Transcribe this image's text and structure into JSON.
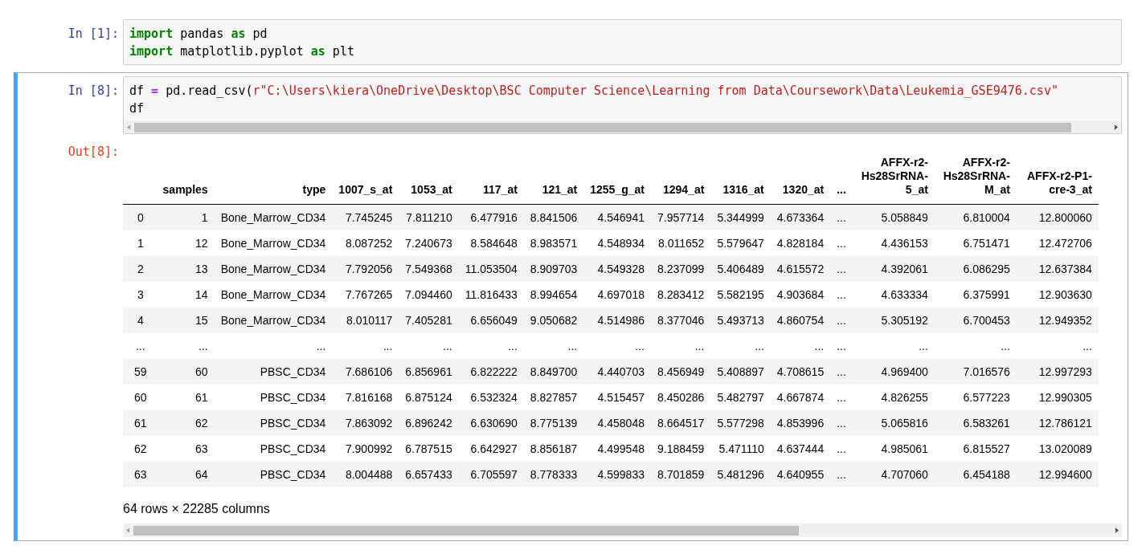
{
  "cells": [
    {
      "selected": false,
      "prompt": "In [1]:",
      "lines": [
        [
          {
            "kind": "keyword",
            "text": "import"
          },
          {
            "kind": "plain",
            "text": " pandas "
          },
          {
            "kind": "keyword",
            "text": "as"
          },
          {
            "kind": "plain",
            "text": " pd"
          }
        ],
        [
          {
            "kind": "keyword",
            "text": "import"
          },
          {
            "kind": "plain",
            "text": " matplotlib.pyplot "
          },
          {
            "kind": "keyword",
            "text": "as"
          },
          {
            "kind": "plain",
            "text": " plt"
          }
        ]
      ],
      "scrollbar": false
    },
    {
      "selected": true,
      "prompt": "In [8]:",
      "lines": [
        [
          {
            "kind": "plain",
            "text": "df "
          },
          {
            "kind": "operator",
            "text": "="
          },
          {
            "kind": "plain",
            "text": " pd.read_csv("
          },
          {
            "kind": "string",
            "text": "r\"C:\\Users\\kiera\\OneDrive\\Desktop\\BSC Computer Science\\Learning from Data\\Coursework\\Data\\Leukemia_GSE9476.csv\""
          }
        ],
        [
          {
            "kind": "plain",
            "text": "df"
          }
        ]
      ],
      "scrollbar": true,
      "output": {
        "prompt": "Out[8]:",
        "columns": [
          "",
          "samples",
          "type",
          "1007_s_at",
          "1053_at",
          "117_at",
          "121_at",
          "1255_g_at",
          "1294_at",
          "1316_at",
          "1320_at",
          "...",
          "AFFX-r2-Hs28SrRNA-5_at",
          "AFFX-r2-Hs28SrRNA-M_at",
          "AFFX-r2-P1-cre-3_at"
        ],
        "rows": [
          [
            "0",
            "1",
            "Bone_Marrow_CD34",
            "7.745245",
            "7.811210",
            "6.477916",
            "8.841506",
            "4.546941",
            "7.957714",
            "5.344999",
            "4.673364",
            "...",
            "5.058849",
            "6.810004",
            "12.800060"
          ],
          [
            "1",
            "12",
            "Bone_Marrow_CD34",
            "8.087252",
            "7.240673",
            "8.584648",
            "8.983571",
            "4.548934",
            "8.011652",
            "5.579647",
            "4.828184",
            "...",
            "4.436153",
            "6.751471",
            "12.472706"
          ],
          [
            "2",
            "13",
            "Bone_Marrow_CD34",
            "7.792056",
            "7.549368",
            "11.053504",
            "8.909703",
            "4.549328",
            "8.237099",
            "5.406489",
            "4.615572",
            "...",
            "4.392061",
            "6.086295",
            "12.637384"
          ],
          [
            "3",
            "14",
            "Bone_Marrow_CD34",
            "7.767265",
            "7.094460",
            "11.816433",
            "8.994654",
            "4.697018",
            "8.283412",
            "5.582195",
            "4.903684",
            "...",
            "4.633334",
            "6.375991",
            "12.903630"
          ],
          [
            "4",
            "15",
            "Bone_Marrow_CD34",
            "8.010117",
            "7.405281",
            "6.656049",
            "9.050682",
            "4.514986",
            "8.377046",
            "5.493713",
            "4.860754",
            "...",
            "5.305192",
            "6.700453",
            "12.949352"
          ],
          [
            "...",
            "...",
            "...",
            "...",
            "...",
            "...",
            "...",
            "...",
            "...",
            "...",
            "...",
            "...",
            "...",
            "...",
            "..."
          ],
          [
            "59",
            "60",
            "PBSC_CD34",
            "7.686106",
            "6.856961",
            "6.822222",
            "8.849700",
            "4.440703",
            "8.456949",
            "5.408897",
            "4.708615",
            "...",
            "4.969400",
            "7.016576",
            "12.997293"
          ],
          [
            "60",
            "61",
            "PBSC_CD34",
            "7.816168",
            "6.875124",
            "6.532324",
            "8.827857",
            "4.515457",
            "8.450286",
            "5.482797",
            "4.667874",
            "...",
            "4.826255",
            "6.577223",
            "12.990305"
          ],
          [
            "61",
            "62",
            "PBSC_CD34",
            "7.863092",
            "6.896242",
            "6.630690",
            "8.775139",
            "4.458048",
            "8.664517",
            "5.577298",
            "4.853996",
            "...",
            "5.065816",
            "6.583261",
            "12.786121"
          ],
          [
            "62",
            "63",
            "PBSC_CD34",
            "7.900992",
            "6.787515",
            "6.642927",
            "8.856187",
            "4.499548",
            "9.188459",
            "5.471110",
            "4.637444",
            "...",
            "4.985061",
            "6.815527",
            "13.020089"
          ],
          [
            "63",
            "64",
            "PBSC_CD34",
            "8.004488",
            "6.657433",
            "6.705597",
            "8.778333",
            "4.599833",
            "8.701859",
            "5.481296",
            "4.640955",
            "...",
            "4.707060",
            "6.454188",
            "12.994600"
          ]
        ],
        "summary": "64 rows × 22285 columns"
      }
    }
  ]
}
